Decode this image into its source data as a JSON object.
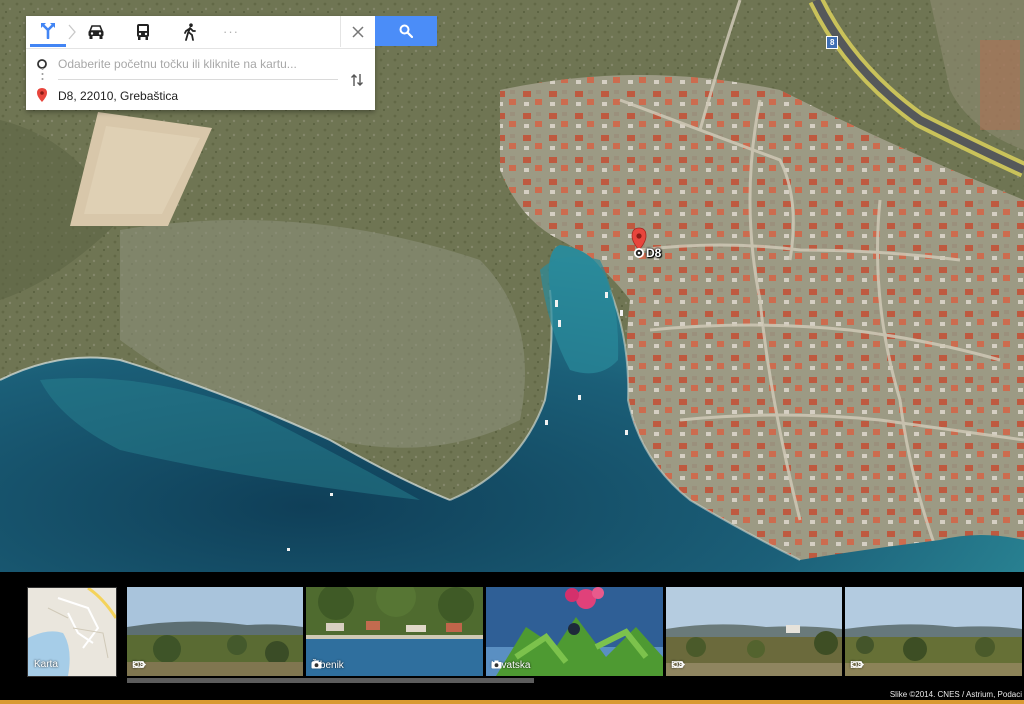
{
  "directions": {
    "modes": [
      {
        "name": "directions",
        "icon": "directions-icon",
        "active": true
      },
      {
        "name": "driving",
        "icon": "car-icon",
        "active": false
      },
      {
        "name": "transit",
        "icon": "bus-icon",
        "active": false
      },
      {
        "name": "walking",
        "icon": "walk-icon",
        "active": false
      },
      {
        "name": "more",
        "icon": "more-icon",
        "active": false
      }
    ],
    "more_label": "···",
    "origin": {
      "value": "",
      "placeholder": "Odaberite početnu točku ili kliknite na kartu..."
    },
    "destination": {
      "value": "D8, 22010, Grebaštica",
      "placeholder": ""
    },
    "close_icon": "close-icon",
    "swap_icon": "swap-icon",
    "search_icon": "search-icon"
  },
  "map": {
    "marker_label": "D8",
    "road_badge": "8",
    "marker_color": "#e8453c"
  },
  "photo_strip": {
    "map_thumb": {
      "label": "Karta"
    },
    "photos": [
      {
        "caption": "D8",
        "icon": "panorama-icon"
      },
      {
        "caption": "Šibenik",
        "icon": "camera-icon"
      },
      {
        "caption": "Hrvatska",
        "icon": "camera-icon"
      },
      {
        "caption": "D8",
        "icon": "panorama-icon"
      },
      {
        "caption": "D8",
        "icon": "panorama-icon"
      }
    ],
    "attribution": "Slike ©2014. CNES / Astrium, Podaci"
  },
  "colors": {
    "accent": "#4285f4",
    "search_button": "#4b8df8",
    "sea": "#1f6f88",
    "land": "#6e7450"
  }
}
